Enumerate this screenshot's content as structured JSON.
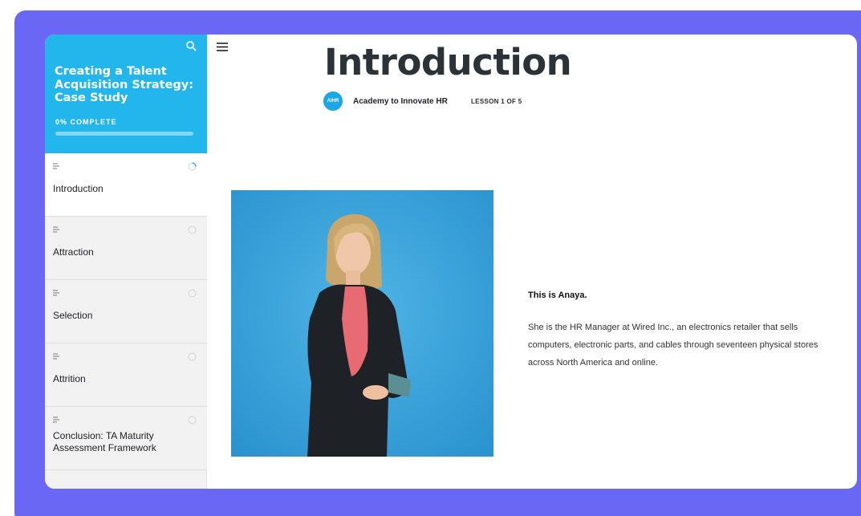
{
  "course": {
    "title": "Creating a Talent Acquisition Strategy: Case Study",
    "progress_label": "0% COMPLETE",
    "progress_fraction": 0
  },
  "sidebar": {
    "lessons": [
      {
        "label": "Introduction",
        "icon": "text-lines-icon",
        "status": "in-progress"
      },
      {
        "label": "Attraction",
        "icon": "text-lines-icon",
        "status": "not-started"
      },
      {
        "label": "Selection",
        "icon": "text-lines-icon",
        "status": "not-started"
      },
      {
        "label": "Attrition",
        "icon": "text-lines-icon",
        "status": "not-started"
      },
      {
        "label": "Conclusion: TA Maturity Assessment Framework",
        "icon": "text-lines-icon",
        "status": "not-started"
      }
    ]
  },
  "lesson": {
    "title": "Introduction",
    "author": "Academy to Innovate HR",
    "author_logo_text": "AIHR",
    "counter": "LESSON 1 OF 5"
  },
  "content": {
    "heading": "This is Anaya.",
    "body": "She is the HR Manager at Wired Inc., an electronics retailer that sells computers, electronic parts, and cables through seventeen physical stores across North America and online."
  },
  "colors": {
    "frame": "#6a67f4",
    "sidebar_header": "#22b6ec",
    "accent": "#1da6e6"
  }
}
